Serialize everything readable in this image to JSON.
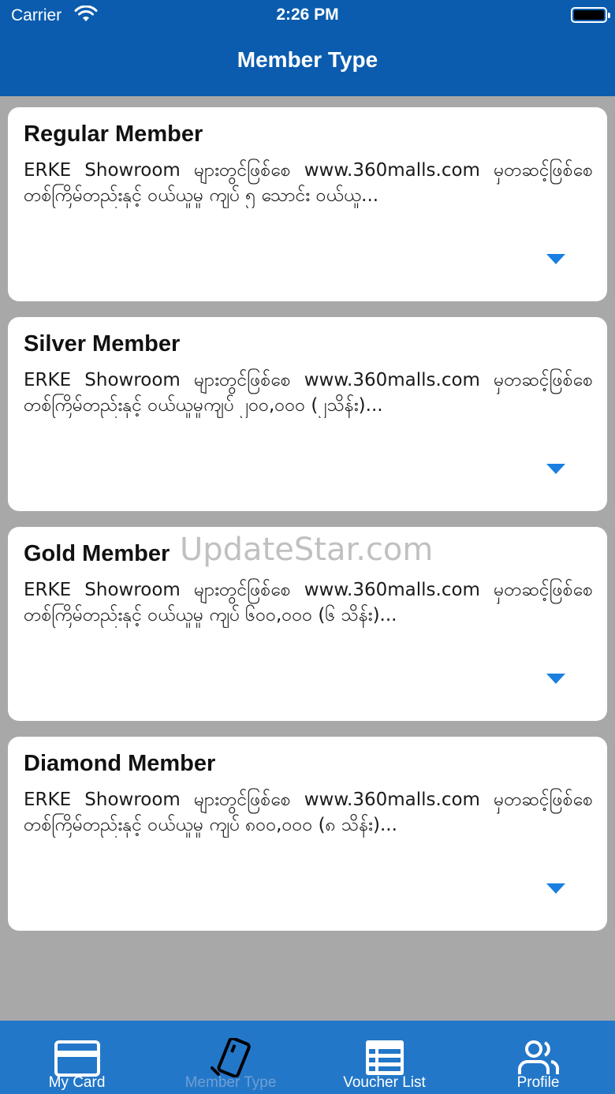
{
  "status_bar": {
    "carrier": "Carrier",
    "time": "2:26 PM"
  },
  "nav": {
    "title": "Member Type"
  },
  "cards": [
    {
      "title": "Regular Member",
      "description": "ERKE Showroom များတွင်ဖြစ်စေ www.360malls.com မှတဆင့်ဖြစ်စေ တစ်ကြိမ်တည်းနှင့် ဝယ်ယူမှု ကျပ် ၅ သောင်း ဝယ်ယူ..."
    },
    {
      "title": "Silver Member",
      "description": "ERKE Showroom များတွင်ဖြစ်စေ www.360malls.com မှတဆင့်ဖြစ်စေ တစ်ကြိမ်တည်းနှင့် ဝယ်ယူမှုကျပ် ၂၀၀,၀၀၀ (၂သိန်း)..."
    },
    {
      "title": "Gold Member",
      "description": "ERKE Showroom များတွင်ဖြစ်စေ www.360malls.com မှတဆင့်ဖြစ်စေ တစ်ကြိမ်တည်းနှင့် ဝယ်ယူမှု ကျပ် ၆၀၀,၀၀၀ (၆ သိန်း)..."
    },
    {
      "title": "Diamond Member",
      "description": "ERKE Showroom များတွင်ဖြစ်စေ www.360malls.com မှတဆင့်ဖြစ်စေ တစ်ကြိမ်တည်းနှင့် ဝယ်ယူမှု ကျပ် ၈၀၀,၀၀၀ (၈ သိန်း)..."
    }
  ],
  "watermark": "UpdateStar.com",
  "tabs": [
    {
      "label": "My Card",
      "icon": "card-icon"
    },
    {
      "label": "Member Type",
      "icon": "member-card-icon",
      "active": true
    },
    {
      "label": "Voucher List",
      "icon": "list-icon"
    },
    {
      "label": "Profile",
      "icon": "people-icon"
    }
  ],
  "colors": {
    "header": "#0b5cae",
    "tabbar": "#2377c8",
    "background": "#a8a8a8",
    "accent": "#1a7fe0",
    "inactive_tab": "#6f9fd4"
  }
}
